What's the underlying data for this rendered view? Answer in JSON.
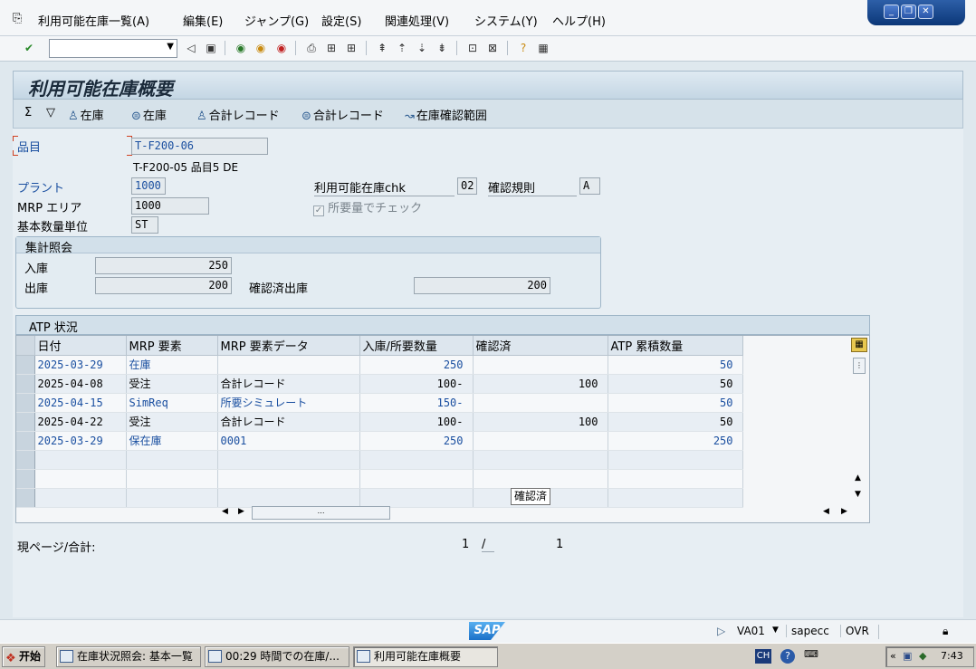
{
  "menu": [
    "利用可能在庫一覧(A)",
    "編集(E)",
    "ジャンプ(G)",
    "設定(S)",
    "関連処理(V)",
    "システム(Y)",
    "ヘルプ(H)"
  ],
  "window_controls": [
    "minimize-icon",
    "restore-icon",
    "close-icon"
  ],
  "toolbar": {
    "command_value": ""
  },
  "title": "利用可能在庫概要",
  "app_toolbar": [
    {
      "label": "",
      "icon": "sigma-icon"
    },
    {
      "label": "",
      "icon": "filter-icon"
    },
    {
      "label": "在庫",
      "icon": "person-icon"
    },
    {
      "label": "在庫",
      "icon": "display-icon"
    },
    {
      "label": "合計レコード",
      "icon": "person-icon"
    },
    {
      "label": "合計レコード",
      "icon": "display-icon"
    },
    {
      "label": "在庫確認範囲",
      "icon": "scope-icon"
    }
  ],
  "header": {
    "material_label": "品目",
    "material_value": "T-F200-06",
    "material_desc": "T-F200-05  品目5 DE",
    "plant_label": "プラント",
    "plant_value": "1000",
    "mrp_area_label": "MRP エリア",
    "mrp_area_value": "1000",
    "base_unit_label": "基本数量単位",
    "base_unit_value": "ST",
    "avail_check_label": "利用可能在庫chk",
    "avail_check_value": "02",
    "check_rule_label": "確認規則",
    "check_rule_value": "A",
    "req_check_label": "所要量でチェック"
  },
  "summary": {
    "title": "集計照会",
    "receipts_label": "入庫",
    "receipts_value": "250",
    "issues_label": "出庫",
    "issues_value": "200",
    "confirmed_label": "確認済出庫",
    "confirmed_value": "200"
  },
  "atp": {
    "title": "ATP 状況",
    "columns": [
      "日付",
      "MRP 要素",
      "MRP 要素データ",
      "入庫/所要数量",
      "確認済",
      "ATP 累積数量"
    ],
    "rows": [
      {
        "date": "2025-03-29",
        "element": "在庫",
        "data": "",
        "qty": "250",
        "confirmed": "",
        "cum": "50",
        "blue": true
      },
      {
        "date": "2025-04-08",
        "element": "受注",
        "data": "合計レコード",
        "qty": "100-",
        "confirmed": "100",
        "cum": "50",
        "blue": false
      },
      {
        "date": "2025-04-15",
        "element": "SimReq",
        "data": "所要シミュレート",
        "qty": "150-",
        "confirmed": "",
        "cum": "50",
        "blue": true
      },
      {
        "date": "2025-04-22",
        "element": "受注",
        "data": "合計レコード",
        "qty": "100-",
        "confirmed": "100",
        "cum": "50",
        "blue": false
      },
      {
        "date": "2025-03-29",
        "element": "保在庫",
        "data": "0001",
        "qty": "250",
        "confirmed": "",
        "cum": "250",
        "blue": true
      }
    ],
    "tooltip": "確認済"
  },
  "paging": {
    "label": "現ページ/合計:",
    "current": "1",
    "separator": "/",
    "total": "1"
  },
  "status": {
    "transaction": "VA01",
    "server": "sapecc",
    "mode": "OVR"
  },
  "taskbar": {
    "start": "开始",
    "tasks": [
      "在庫状況照会: 基本一覧",
      "00:29 時間での在庫/...",
      "利用可能在庫概要"
    ],
    "lang": "CH",
    "clock": "7:43"
  }
}
